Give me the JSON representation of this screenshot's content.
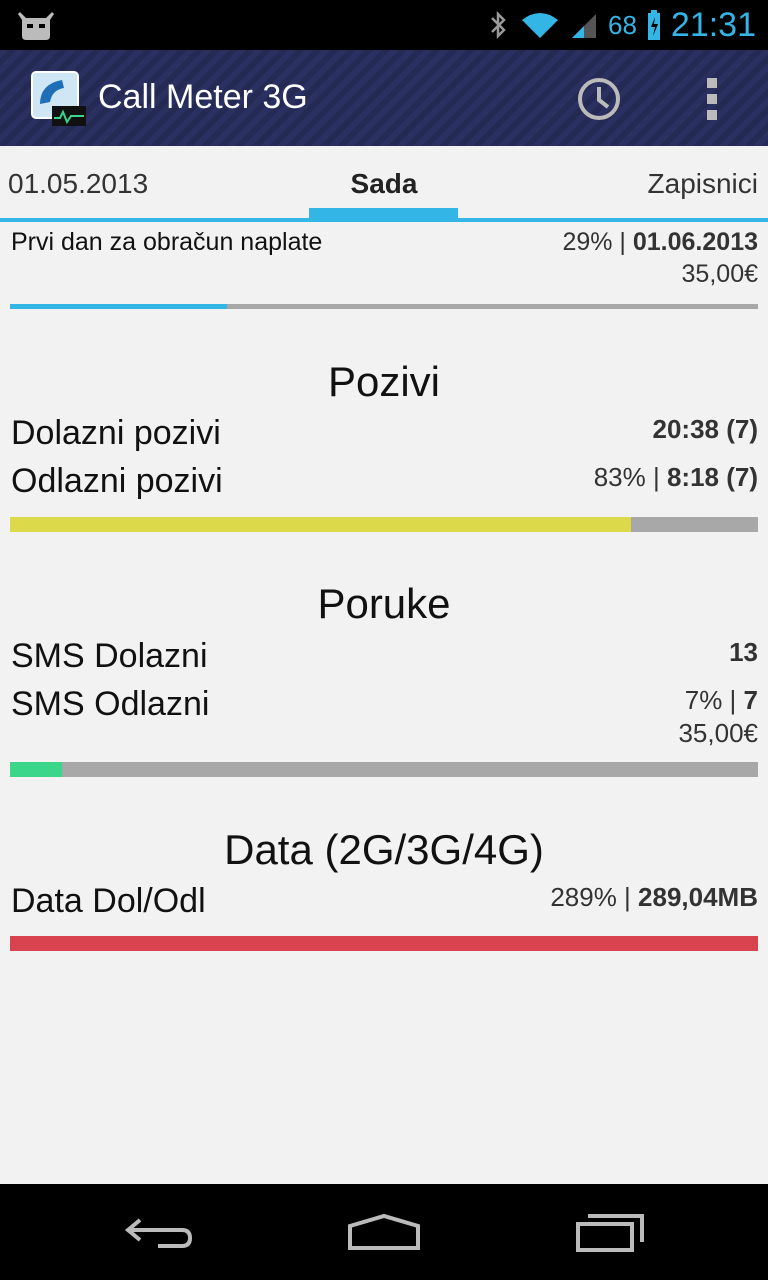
{
  "status_bar": {
    "icons": [
      "cyanogenmod-robot-icon",
      "bluetooth-icon",
      "wifi-icon",
      "signal-icon",
      "battery-icon"
    ],
    "battery": "68",
    "time": "21:31"
  },
  "action_bar": {
    "title": "Call Meter 3G",
    "icons": [
      "app-icon",
      "history-clock-icon",
      "overflow-menu-icon"
    ]
  },
  "tabs": {
    "prev": "01.05.2013",
    "current": "Sada",
    "next": "Zapisnici"
  },
  "billing": {
    "label": "Prvi dan za obračun naplate",
    "percent": "29% | ",
    "date": "01.06.2013",
    "cost": "35,00€",
    "progress_percent": 29,
    "color": "#33b5e5"
  },
  "calls": {
    "title": "Pozivi",
    "incoming_label": "Dolazni pozivi",
    "incoming_value": "20:38 (7)",
    "outgoing_label": "Odlazni pozivi",
    "outgoing_percent": "83% | ",
    "outgoing_value": "8:18 (7)",
    "progress_percent": 83,
    "color": "#dcd94a"
  },
  "messages": {
    "title": "Poruke",
    "incoming_label": "SMS Dolazni",
    "incoming_value": "13",
    "outgoing_label": "SMS Odlazni",
    "outgoing_percent": "7% | ",
    "outgoing_value": "7",
    "cost": "35,00€",
    "progress_percent": 7,
    "color": "#3cd68a"
  },
  "data": {
    "title": "Data (2G/3G/4G)",
    "label": "Data Dol/Odl",
    "percent": "289% | ",
    "value": "289,04MB",
    "progress_percent": 100,
    "color": "#d9434f"
  },
  "nav_bar": {
    "icons": [
      "back-icon",
      "home-icon",
      "recent-apps-icon"
    ]
  }
}
